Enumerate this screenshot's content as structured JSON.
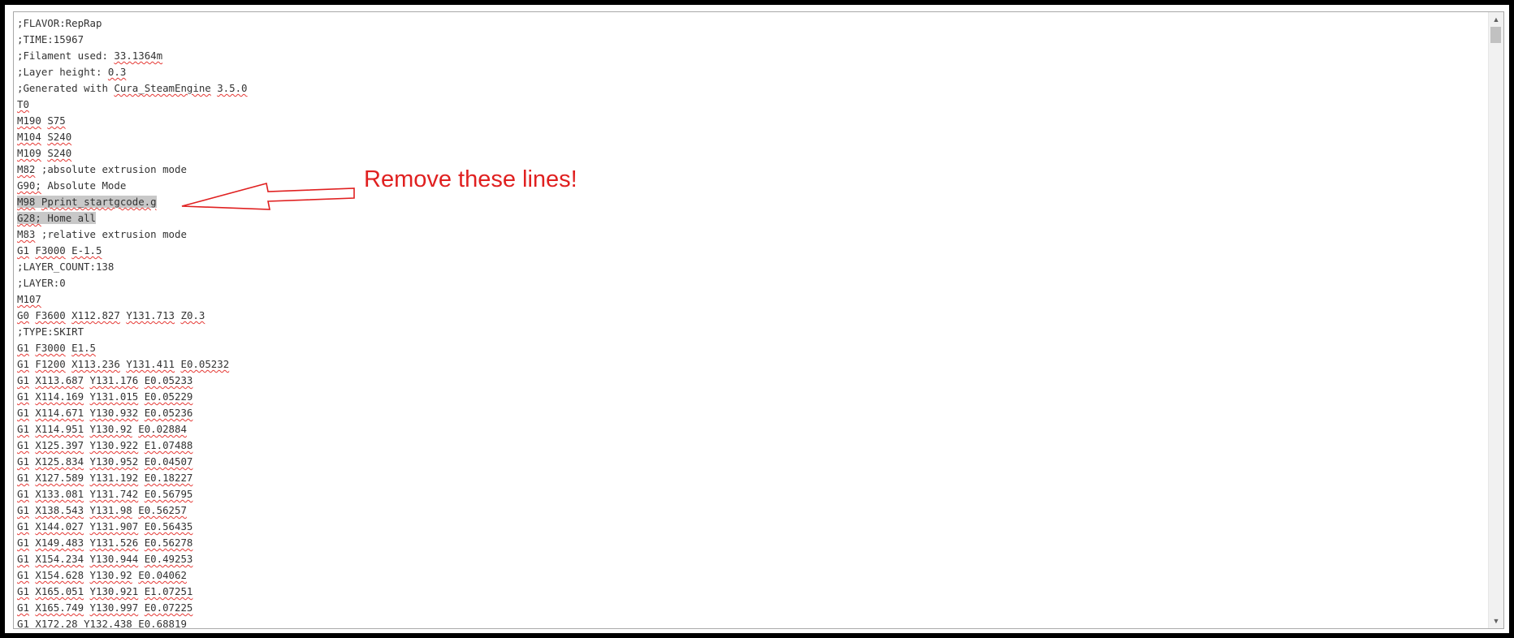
{
  "editor": {
    "lines": [
      ";FLAVOR:RepRap",
      ";TIME:15967",
      ";Filament used: 33.1364m",
      ";Layer height: 0.3",
      ";Generated with Cura_SteamEngine 3.5.0",
      "T0",
      "M190 S75",
      "M104 S240",
      "M109 S240",
      "M82 ;absolute extrusion mode",
      "G90; Absolute Mode",
      "M98 Pprint_startgcode.g",
      "G28; Home all",
      "M83 ;relative extrusion mode",
      "G1 F3000 E-1.5",
      ";LAYER_COUNT:138",
      ";LAYER:0",
      "M107",
      "G0 F3600 X112.827 Y131.713 Z0.3",
      ";TYPE:SKIRT",
      "G1 F3000 E1.5",
      "G1 F1200 X113.236 Y131.411 E0.05232",
      "G1 X113.687 Y131.176 E0.05233",
      "G1 X114.169 Y131.015 E0.05229",
      "G1 X114.671 Y130.932 E0.05236",
      "G1 X114.951 Y130.92 E0.02884",
      "G1 X125.397 Y130.922 E1.07488",
      "G1 X125.834 Y130.952 E0.04507",
      "G1 X127.589 Y131.192 E0.18227",
      "G1 X133.081 Y131.742 E0.56795",
      "G1 X138.543 Y131.98 E0.56257",
      "G1 X144.027 Y131.907 E0.56435",
      "G1 X149.483 Y131.526 E0.56278",
      "G1 X154.234 Y130.944 E0.49253",
      "G1 X154.628 Y130.92 E0.04062",
      "G1 X165.051 Y130.921 E1.07251",
      "G1 X165.749 Y130.997 E0.07225",
      "G1 X172.28 Y132.438 E0.68819"
    ],
    "selected_lines": [
      11,
      12
    ]
  },
  "annotation": {
    "text": "Remove these lines!",
    "color": "#e02020"
  },
  "scrollbar": {
    "up_icon": "scroll-up-arrow-icon",
    "down_icon": "scroll-down-arrow-icon"
  }
}
